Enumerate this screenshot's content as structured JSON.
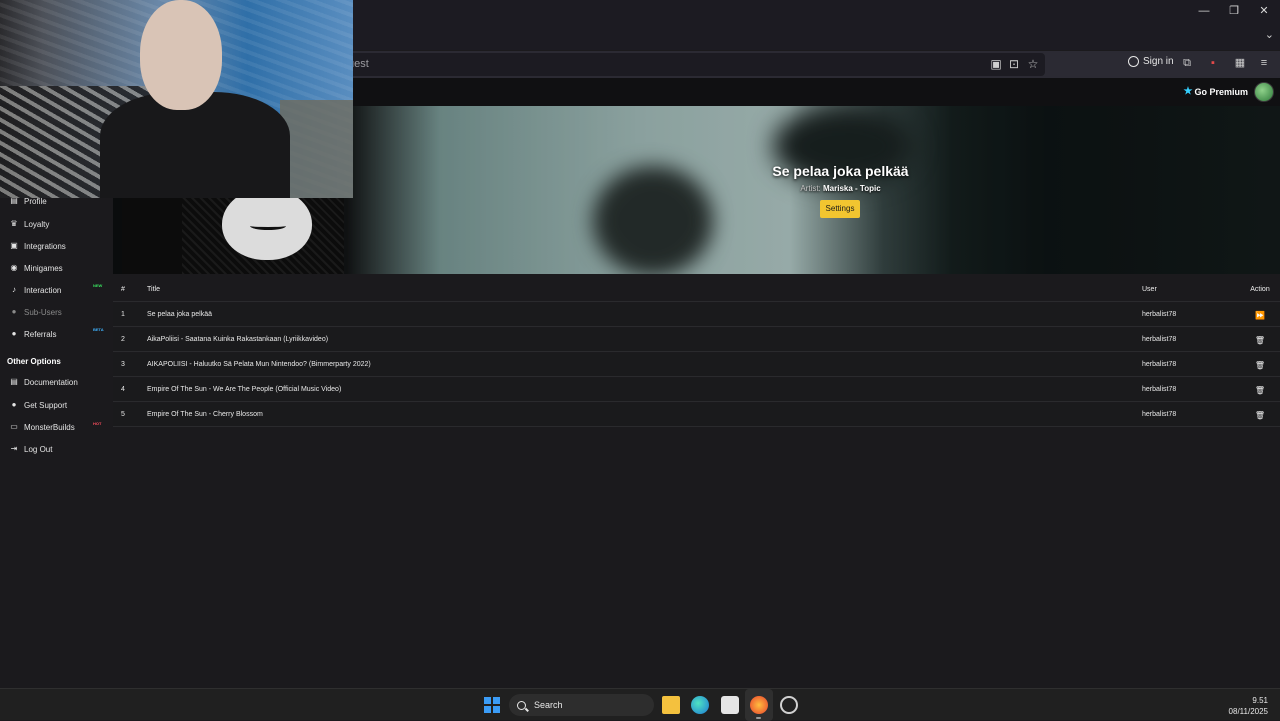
{
  "browser": {
    "url_fragment": "uest",
    "sign_in": "Sign in",
    "window_controls": [
      "minimize",
      "maximize",
      "close"
    ]
  },
  "site": {
    "go_premium": "Go Premium"
  },
  "hero": {
    "title": "Se pelaa joka pelkää",
    "artist_label": "Artist:",
    "artist": "Mariska - Topic",
    "settings_label": "Settings"
  },
  "sidebar": {
    "items": [
      {
        "label": "Profile",
        "icon": "id-card-icon",
        "badge": ""
      },
      {
        "label": "Loyalty",
        "icon": "trophy-icon",
        "badge": ""
      },
      {
        "label": "Integrations",
        "icon": "puzzle-icon",
        "badge": ""
      },
      {
        "label": "Minigames",
        "icon": "gamepad-icon",
        "badge": ""
      },
      {
        "label": "Interaction",
        "icon": "music-icon",
        "badge": "NEW"
      },
      {
        "label": "Sub-Users",
        "icon": "users-icon",
        "badge": ""
      },
      {
        "label": "Referrals",
        "icon": "user-plus-icon",
        "badge": "BETA"
      }
    ],
    "section_title": "Other Options",
    "other_items": [
      {
        "label": "Documentation",
        "icon": "book-icon",
        "badge": ""
      },
      {
        "label": "Get Support",
        "icon": "help-icon",
        "badge": ""
      },
      {
        "label": "MonsterBuilds",
        "icon": "monitor-icon",
        "badge": "HOT"
      },
      {
        "label": "Log Out",
        "icon": "logout-icon",
        "badge": ""
      }
    ]
  },
  "table": {
    "headers": {
      "num": "#",
      "title": "Title",
      "user": "User",
      "action": "Action"
    },
    "rows": [
      {
        "num": "1",
        "title": "Se pelaa joka pelkää",
        "user": "herbalist78",
        "action": "skip-icon"
      },
      {
        "num": "2",
        "title": "AikaPoliisi - Saatana Kuinka Rakastankaan (Lyriikkavideo)",
        "user": "herbalist78",
        "action": "trash-icon"
      },
      {
        "num": "3",
        "title": "AIKAPOLIISI - Haluutko Sä Pelata Mun Nintendoo? (Bimmerparty 2022)",
        "user": "herbalist78",
        "action": "trash-icon"
      },
      {
        "num": "4",
        "title": "Empire Of The Sun - We Are The People (Official Music Video)",
        "user": "herbalist78",
        "action": "trash-icon"
      },
      {
        "num": "5",
        "title": "Empire Of The Sun - Cherry Blossom",
        "user": "herbalist78",
        "action": "trash-icon"
      }
    ]
  },
  "taskbar": {
    "search": "Search",
    "time": "9.51",
    "date": "08/11/2025"
  },
  "colors": {
    "accent_settings": "#f2c530",
    "badge_new": "#39e15e",
    "badge_beta": "#3fb3ff"
  }
}
